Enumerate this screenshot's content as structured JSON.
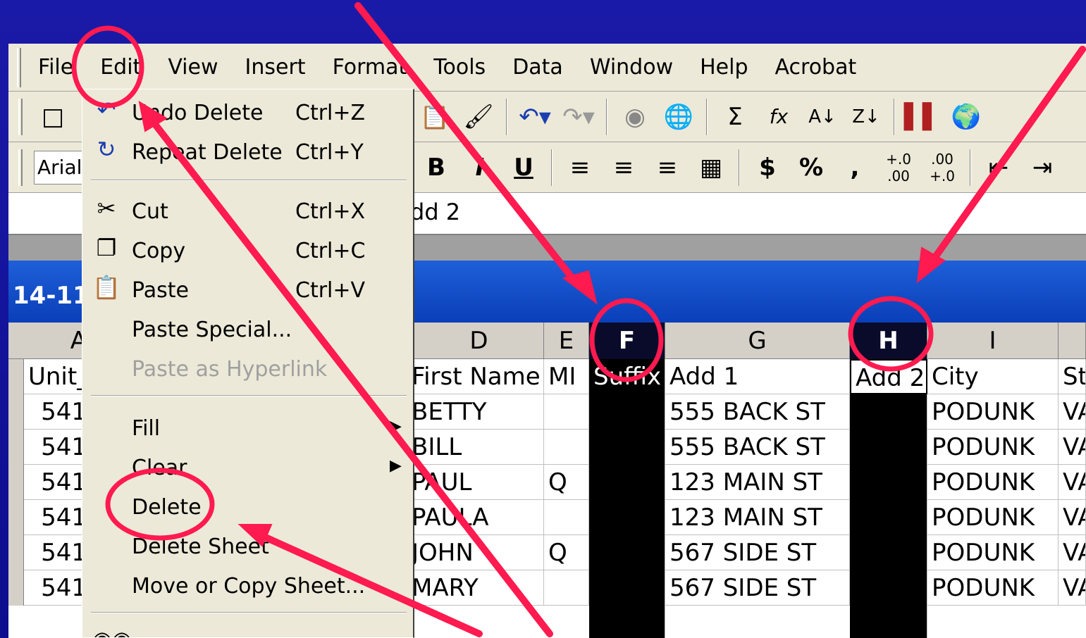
{
  "menubar": {
    "items": [
      "File",
      "Edit",
      "View",
      "Insert",
      "Format",
      "Tools",
      "Data",
      "Window",
      "Help",
      "Acrobat"
    ]
  },
  "toolbar": {
    "font_name": "Arial",
    "icons": [
      "new-icon",
      "paste-icon",
      "format-painter-icon",
      "undo-icon",
      "redo-icon",
      "web-icon",
      "globe-icon",
      "autosum-icon",
      "function-icon",
      "sort-ascending-icon",
      "sort-descending-icon",
      "chart-icon",
      "map-icon"
    ],
    "format_buttons": [
      "B",
      "I",
      "U",
      "$",
      "%",
      ","
    ],
    "sum_symbol": "Σ",
    "fx_symbol": "fx"
  },
  "formula_bar": {
    "value": "dd 2"
  },
  "workbook": {
    "title": "14-11"
  },
  "edit_menu": {
    "items": [
      {
        "label": "Undo Delete",
        "shortcut": "Ctrl+Z"
      },
      {
        "label": "Repeat Delete",
        "shortcut": "Ctrl+Y"
      },
      {
        "label": "Cut",
        "shortcut": "Ctrl+X"
      },
      {
        "label": "Copy",
        "shortcut": "Ctrl+C"
      },
      {
        "label": "Paste",
        "shortcut": "Ctrl+V"
      },
      {
        "label": "Paste Special...",
        "shortcut": ""
      },
      {
        "label": "Paste as Hyperlink",
        "shortcut": ""
      },
      {
        "label": "Fill",
        "shortcut": ""
      },
      {
        "label": "Clear",
        "shortcut": ""
      },
      {
        "label": "Delete",
        "shortcut": ""
      },
      {
        "label": "Delete Sheet",
        "shortcut": ""
      },
      {
        "label": "Move or Copy Sheet...",
        "shortcut": ""
      }
    ]
  },
  "sheet": {
    "columns": [
      "A",
      "D",
      "E",
      "F",
      "G",
      "H",
      "I"
    ],
    "header_row": [
      "Unit_",
      "First Name",
      "MI",
      "Suffix",
      "Add 1",
      "Add 2",
      "City",
      "St"
    ],
    "rows": [
      [
        "541",
        "BETTY",
        "",
        "",
        "555 BACK ST",
        "",
        "PODUNK",
        "VA"
      ],
      [
        "541",
        "BILL",
        "",
        "",
        "555 BACK ST",
        "",
        "PODUNK",
        "VA"
      ],
      [
        "541",
        "PAUL",
        "Q",
        "",
        "123 MAIN ST",
        "",
        "PODUNK",
        "VA"
      ],
      [
        "541",
        "PAULA",
        "",
        "",
        "123 MAIN ST",
        "",
        "PODUNK",
        "VA"
      ],
      [
        "541",
        "JOHN",
        "Q",
        "",
        "567 SIDE ST",
        "",
        "PODUNK",
        "VA"
      ],
      [
        "541",
        "MARY",
        "",
        "",
        "567 SIDE ST",
        "",
        "PODUNK",
        "VA"
      ]
    ]
  },
  "colors": {
    "annotation": "#ff1a4f",
    "selection": "#000000"
  }
}
